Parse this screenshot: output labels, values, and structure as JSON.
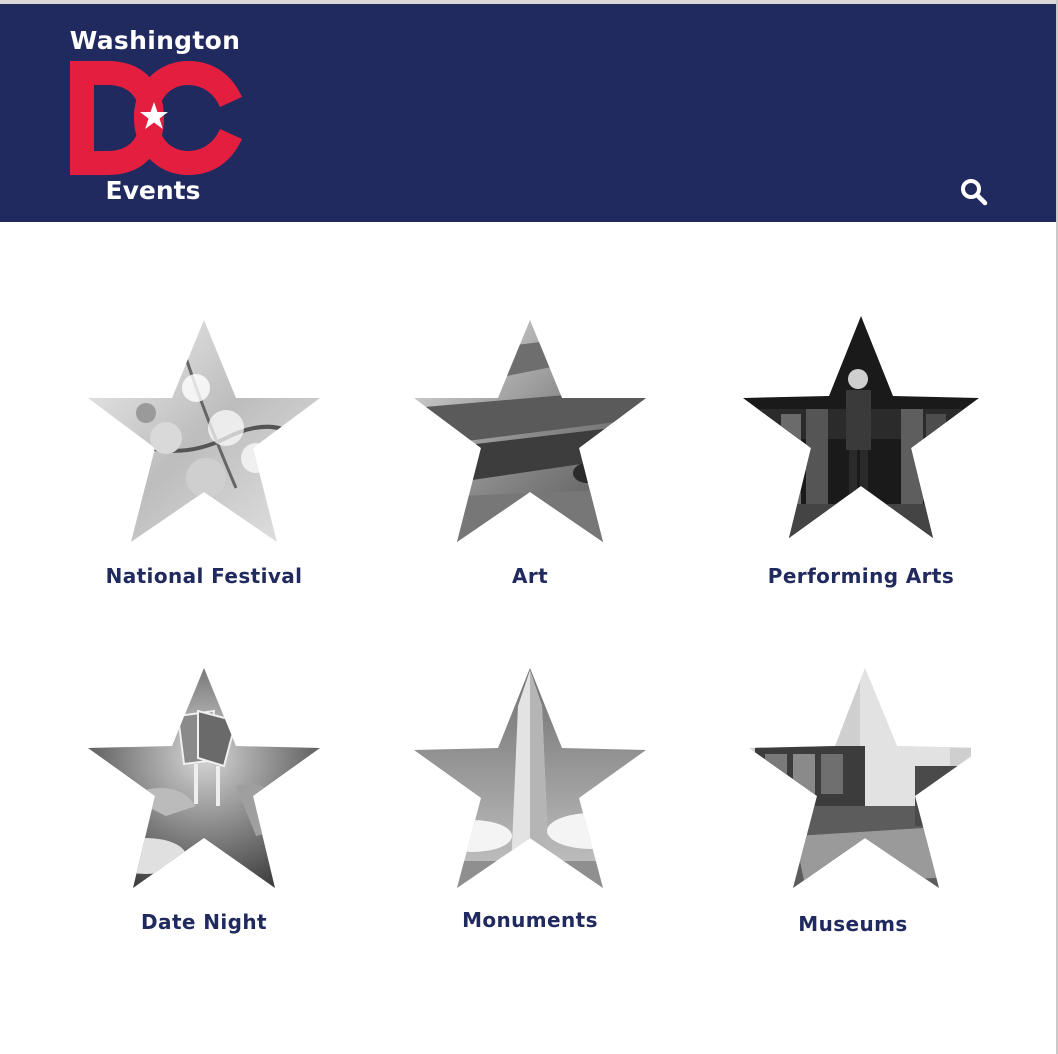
{
  "header": {
    "logo": {
      "top_text": "Washington",
      "dc_text": "DC",
      "bottom_text": "Events"
    },
    "search_icon": "search-icon"
  },
  "colors": {
    "header_bg": "#212a5e",
    "logo_red": "#e41e3f",
    "label_text": "#212a5e"
  },
  "categories": [
    {
      "label": "National Festival",
      "image": "cherry-blossom-photo"
    },
    {
      "label": "Art",
      "image": "paint-brushes-photo"
    },
    {
      "label": "Performing Arts",
      "image": "stage-singer-photo"
    },
    {
      "label": "Date Night",
      "image": "wine-glasses-toast-photo"
    },
    {
      "label": "Monuments",
      "image": "washington-monument-photo"
    },
    {
      "label": "Museums",
      "image": "museum-building-photo"
    }
  ]
}
